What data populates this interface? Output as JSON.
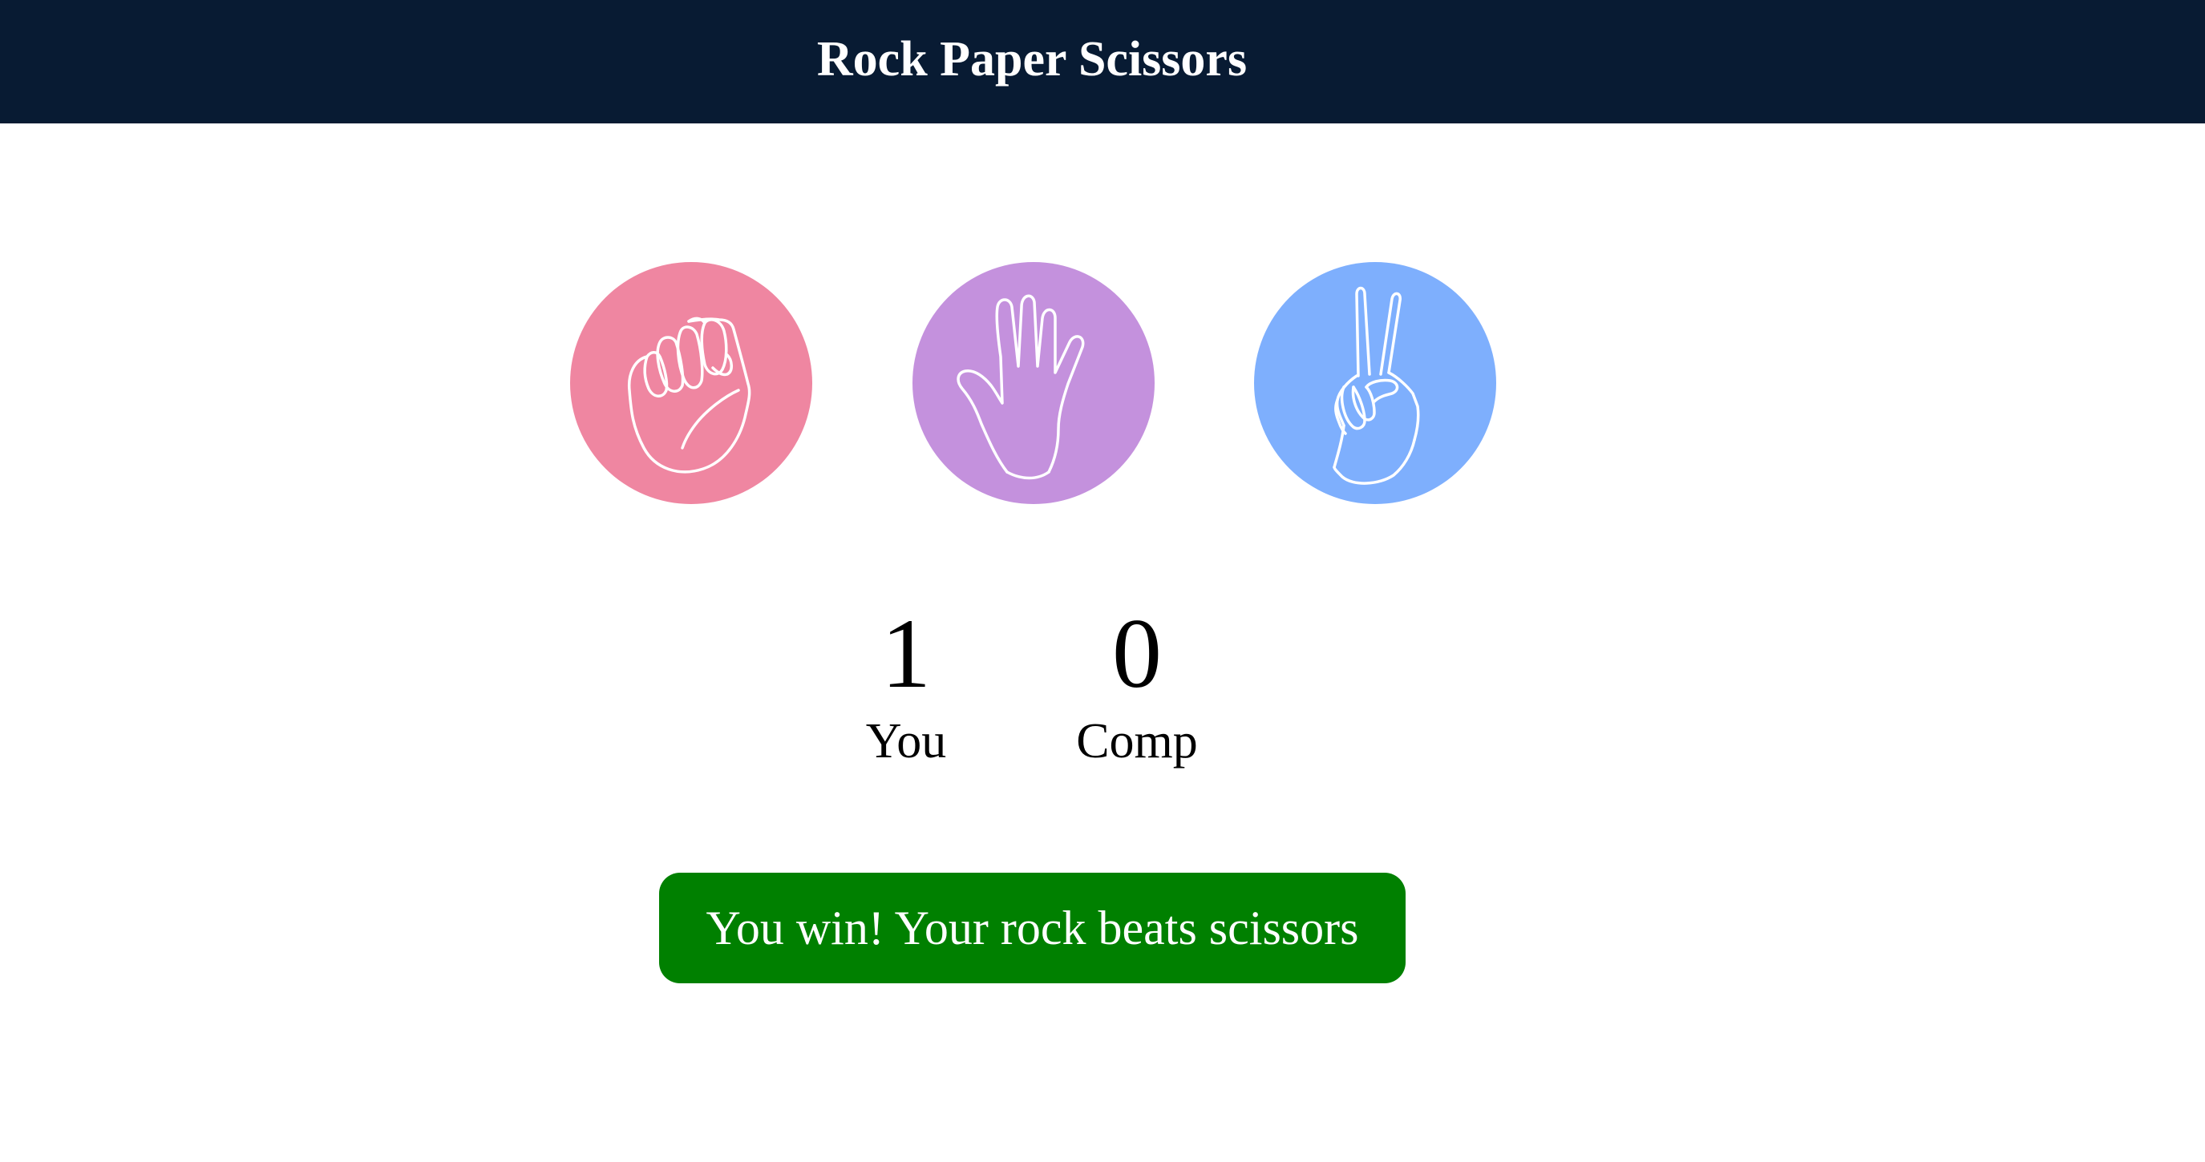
{
  "header": {
    "title": "Rock Paper Scissors",
    "background": "#081b33"
  },
  "choices": [
    {
      "name": "rock",
      "icon": "fist-icon",
      "color": "#ef86a1"
    },
    {
      "name": "paper",
      "icon": "open-hand-icon",
      "color": "#c491dd"
    },
    {
      "name": "scissors",
      "icon": "peace-sign-icon",
      "color": "#7eaffd"
    }
  ],
  "scoreboard": {
    "user": {
      "score": "1",
      "label": "You"
    },
    "comp": {
      "score": "0",
      "label": "Comp"
    }
  },
  "message": {
    "text": "You win! Your rock beats scissors",
    "color": "#008000"
  }
}
